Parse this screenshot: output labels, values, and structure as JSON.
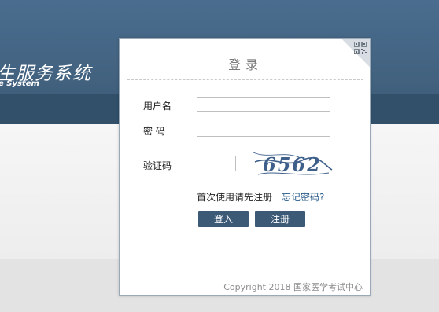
{
  "banner": {
    "title": "生服务系统",
    "subtitle": "e System"
  },
  "login": {
    "title": "登录",
    "qr_icon": "qr-code-icon",
    "fields": {
      "username_label": "用户名",
      "password_label": "密 码",
      "captcha_label": "验证码",
      "username_value": "",
      "password_value": "",
      "captcha_value": ""
    },
    "captcha_text": "6562",
    "first_time_link": "首次使用请先注册",
    "forgot_password_link": "忘记密码?",
    "login_button": "登入",
    "register_button": "注册",
    "copyright": "Copyright 2018 国家医学考试中心"
  },
  "colors": {
    "header": "#42627f",
    "button": "#3c5a76",
    "forgot_link": "#2a5d8a",
    "captcha_ink": "#3d5f8a"
  }
}
